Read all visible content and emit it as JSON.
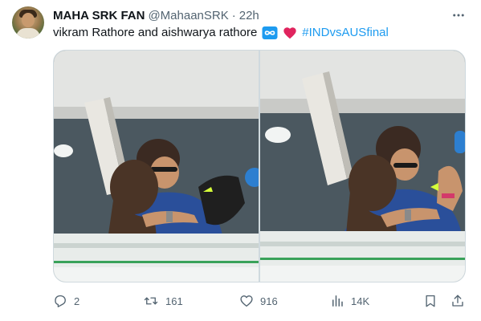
{
  "tweet": {
    "author": {
      "display_name": "MAHA SRK FAN",
      "handle": "@MahaanSRK",
      "separator": "·",
      "time": "22h"
    },
    "text": "vikram Rathore and aishwarya rathore",
    "emojis": [
      "infinity-icon",
      "heart-icon"
    ],
    "hashtag": "#INDvsAUSfinal",
    "media": {
      "count": 2,
      "photos": [
        {
          "name": "stadium-hug-photo-1"
        },
        {
          "name": "stadium-hug-photo-2"
        }
      ]
    },
    "actions": {
      "replies": "2",
      "reposts": "161",
      "likes": "916",
      "views": "14K"
    },
    "colors": {
      "accent": "#1d9bf0",
      "muted": "#536471",
      "text": "#0f1419",
      "heart": "#e0245e",
      "infinity": "#1d9bf0"
    }
  }
}
